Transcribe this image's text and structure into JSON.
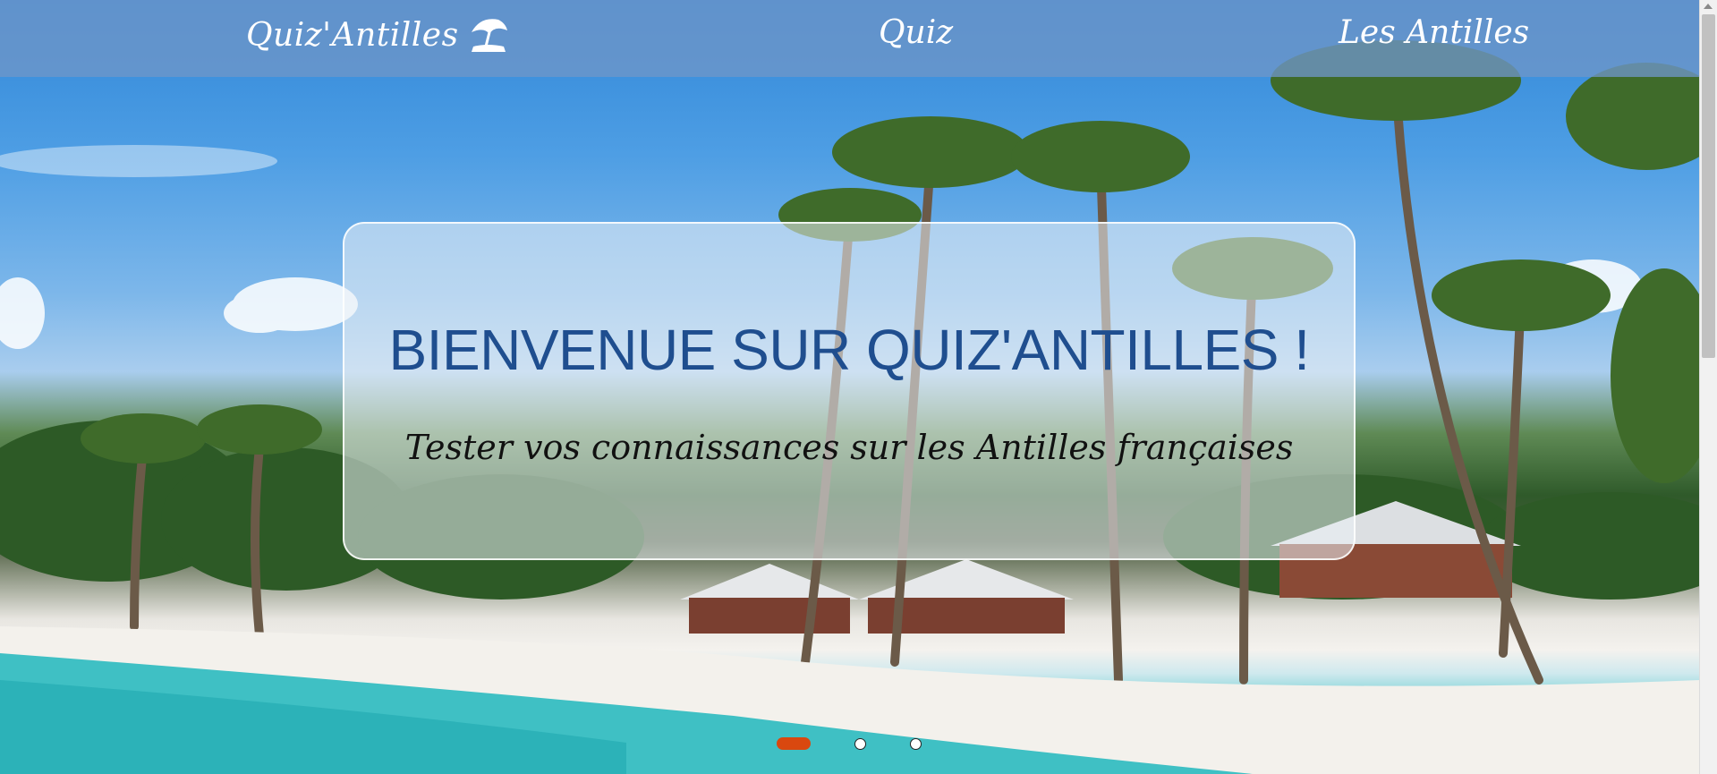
{
  "navbar": {
    "brand_label": "Quiz'Antilles",
    "brand_icon": "beach-umbrella-icon",
    "links": [
      {
        "label": "Quiz"
      },
      {
        "label": "Les Antilles"
      }
    ]
  },
  "hero": {
    "title": "BIENVENUE SUR QUIZ'ANTILLES !",
    "subtitle": "Tester vos connaissances sur les Antilles françaises"
  },
  "carousel": {
    "active_index": 1,
    "total_slides": 3,
    "active_color": "#d9480f"
  },
  "colors": {
    "navbar": "#6e96c8",
    "title": "#1f4e8f",
    "subtitle": "#111111"
  }
}
